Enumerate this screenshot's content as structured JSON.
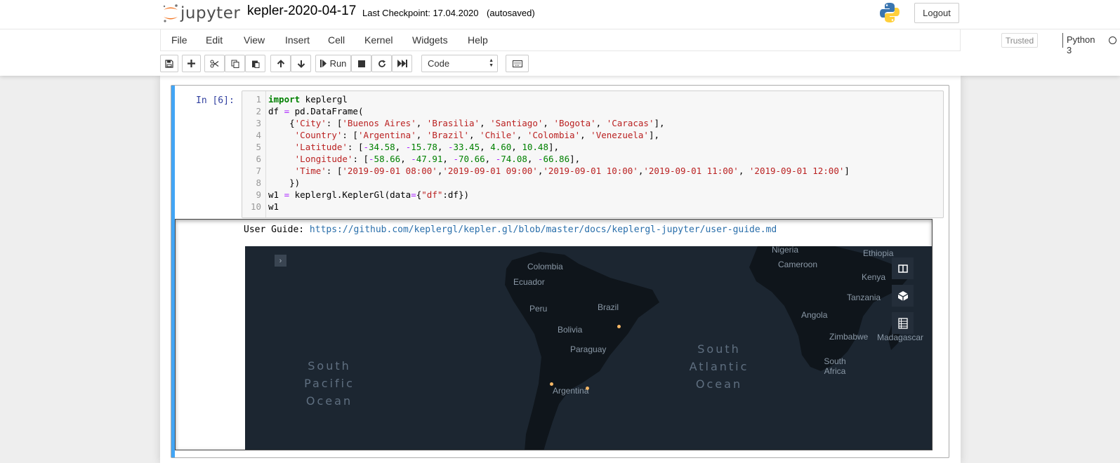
{
  "header": {
    "app_name": "jupyter",
    "notebook_name": "kepler-2020-04-17",
    "checkpoint": "Last Checkpoint: 17.04.2020",
    "autosave": "(autosaved)",
    "logout_label": "Logout"
  },
  "menu": {
    "items": [
      "File",
      "Edit",
      "View",
      "Insert",
      "Cell",
      "Kernel",
      "Widgets",
      "Help"
    ],
    "trusted": "Trusted",
    "kernel": "Python 3"
  },
  "toolbar": {
    "run_label": "Run",
    "cell_type": "Code",
    "icons": [
      "save-icon",
      "plus-icon",
      "scissors-icon",
      "copy-icon",
      "paste-icon",
      "arrow-up-icon",
      "arrow-down-icon",
      "run-icon",
      "stop-icon",
      "restart-icon",
      "fast-forward-icon",
      "keyboard-icon"
    ]
  },
  "cell": {
    "prompt": "In [6]:",
    "line_numbers": [
      "1",
      "2",
      "3",
      "4",
      "5",
      "6",
      "7",
      "8",
      "9",
      "10"
    ],
    "code_lines": [
      "import keplergl",
      "df = pd.DataFrame(",
      "    {'City': ['Buenos Aires', 'Brasilia', 'Santiago', 'Bogota', 'Caracas'],",
      "     'Country': ['Argentina', 'Brazil', 'Chile', 'Colombia', 'Venezuela'],",
      "     'Latitude': [-34.58, -15.78, -33.45, 4.60, 10.48],",
      "     'Longitude': [-58.66, -47.91, -70.66, -74.08, -66.86],",
      "     'Time': ['2019-09-01 08:00','2019-09-01 09:00','2019-09-01 10:00','2019-09-01 11:00', '2019-09-01 12:00']",
      "    })",
      "w1 = keplergl.KeplerGl(data={\"df\":df})",
      "w1"
    ]
  },
  "output": {
    "user_guide_label": "User Guide: ",
    "user_guide_url": "https://github.com/keplergl/kepler.gl/blob/master/docs/keplergl-jupyter/user-guide.md"
  },
  "map": {
    "countries": [
      "Nigeria",
      "Ethiopia",
      "Colombia",
      "Cameroon",
      "Ecuador",
      "Kenya",
      "Tanzania",
      "Brazil",
      "Peru",
      "Angola",
      "Bolivia",
      "Zimbabwe",
      "Madagascar",
      "Paraguay",
      "South Africa",
      "Argentina"
    ],
    "oceans": [
      "South Pacific Ocean",
      "South Atlantic Ocean"
    ],
    "controls": [
      "split-map-icon",
      "3d-cube-icon",
      "legend-icon"
    ],
    "point_color": "#f6b766",
    "background_color": "#1c2631"
  }
}
